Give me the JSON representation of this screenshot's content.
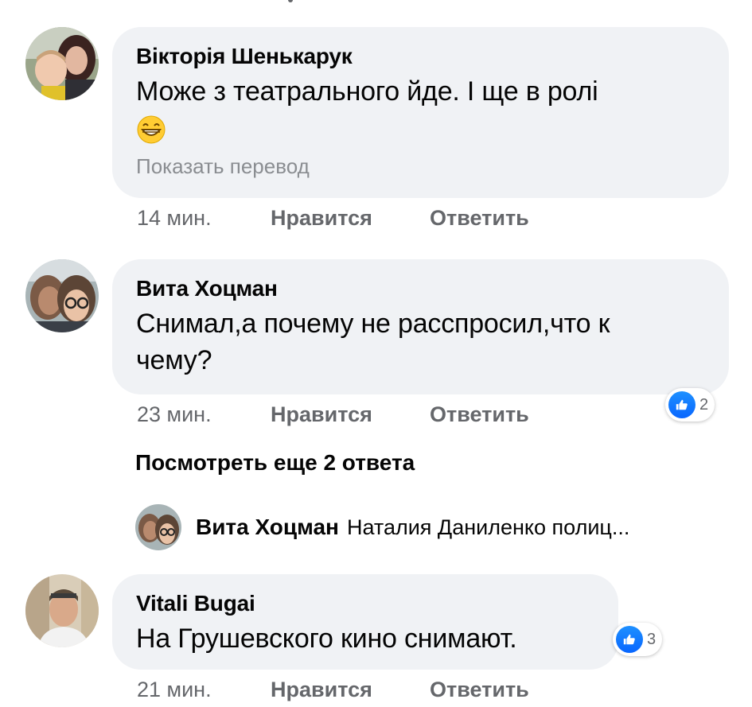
{
  "comments": [
    {
      "author": "Вікторія Шенькарук",
      "text": "Може з театрального йде.  І ще в ролі",
      "emoji_icon": "grinning-face-emoji",
      "translate": "Показать перевод",
      "time": "14 мин.",
      "like": "Нравится",
      "reply": "Ответить"
    },
    {
      "author": "Вита Хоцман",
      "text_line1": "Снимал,а почему не расспросил,что к",
      "text_line2": "чему?",
      "time": "23 мин.",
      "like": "Нравится",
      "reply": "Ответить",
      "reactions": {
        "icon": "like-reaction-icon",
        "count": "2"
      }
    },
    {
      "author": "Vitali  Bugai",
      "text": "На Грушевского кино снимают.",
      "time": "21 мин.",
      "like": "Нравится",
      "reply": "Ответить",
      "reactions": {
        "icon": "like-reaction-icon",
        "count": "3"
      }
    }
  ],
  "more_replies": "Посмотреть еще 2 ответа",
  "reply_preview": {
    "author": "Вита Хоцман",
    "text": "Наталия Даниленко полиц..."
  },
  "colors": {
    "bubble": "#f0f2f5",
    "meta": "#65676b",
    "translate": "#8a8d91",
    "like_blue": "#0866ff"
  }
}
